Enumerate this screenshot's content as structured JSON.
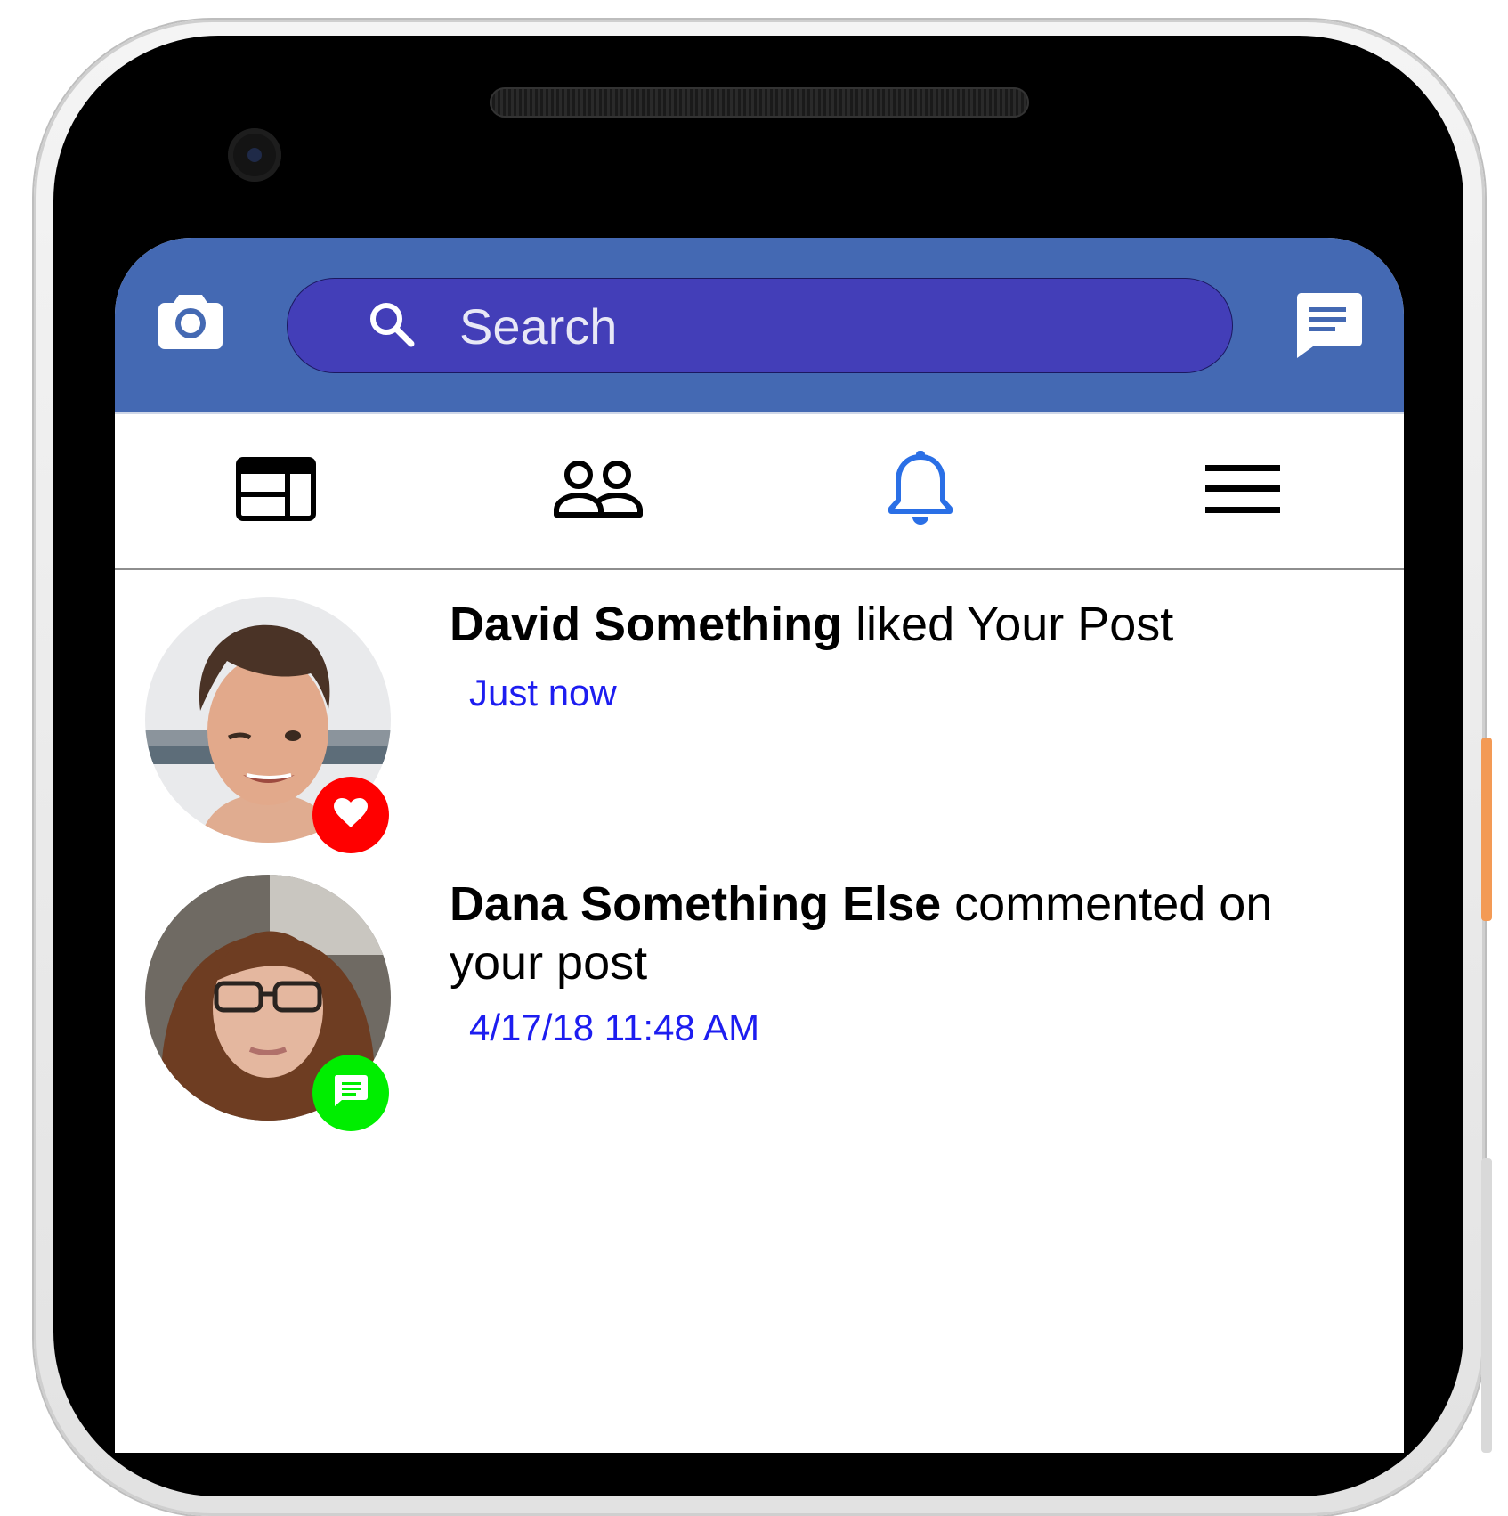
{
  "app": {
    "search": {
      "placeholder": "Search",
      "value": ""
    },
    "icons": {
      "camera": "camera-icon",
      "messages": "messages-icon",
      "search": "search-icon",
      "news_feed": "news-feed-icon",
      "friends": "friends-icon",
      "notifications": "bell-icon",
      "menu": "hamburger-menu-icon"
    },
    "colors": {
      "header": "#4469b3",
      "search_bg": "#433eb8",
      "active_tab": "#2a6fe6",
      "timestamp": "#1d1df0",
      "like_badge": "#ff0000",
      "comment_badge": "#00ee00"
    },
    "nav": {
      "active": "notifications",
      "tabs": [
        "news_feed",
        "friends",
        "notifications",
        "menu"
      ]
    }
  },
  "notifications": [
    {
      "actor": "David Something",
      "action": "liked Your Post",
      "time": "Just now",
      "badge": "heart-icon"
    },
    {
      "actor": "Dana Something Else",
      "action": "commented on your post",
      "time": "4/17/18 11:48 AM",
      "badge": "comment-icon"
    }
  ]
}
